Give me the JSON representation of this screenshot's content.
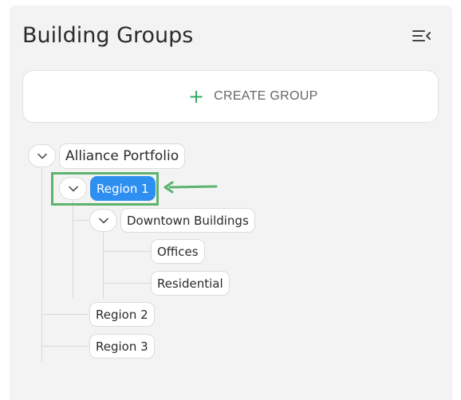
{
  "header": {
    "title": "Building Groups",
    "collapse_icon": "collapse-menu-icon"
  },
  "create": {
    "label": "CREATE GROUP",
    "icon": "plus-icon"
  },
  "tree": {
    "root": {
      "label": "Alliance Portfolio"
    },
    "region1": {
      "label": "Region 1",
      "selected": true
    },
    "downtown": {
      "label": "Downtown Buildings"
    },
    "offices": {
      "label": "Offices"
    },
    "residential": {
      "label": "Residential"
    },
    "region2": {
      "label": "Region 2"
    },
    "region3": {
      "label": "Region 3"
    }
  },
  "colors": {
    "accent": "#2f8ff0",
    "plus": "#2eaa63",
    "annotation": "#5db36f"
  }
}
